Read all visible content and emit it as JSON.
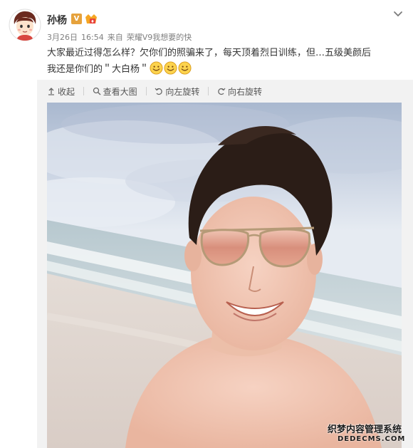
{
  "post": {
    "username": "孙杨",
    "vip_badge": "V",
    "meta": {
      "date": "3月26日",
      "time": "16:54",
      "source_prefix": "来自",
      "device": "荣耀V9",
      "slogan": "我想要的快"
    },
    "text_line1": "大家最近过得怎么样？欠你们的照骗来了，每天顶着烈日训练，但…五级美颜后",
    "text_line2": "我还是你们的＂大白杨＂",
    "emoji_names": [
      "smile-emoji",
      "smile-emoji",
      "smile-emoji"
    ]
  },
  "toolbar": {
    "collapse": "收起",
    "view_large": "查看大图",
    "rotate_left": "向左旋转",
    "rotate_right": "向右旋转"
  },
  "watermark": {
    "title": "织梦内容管理系统",
    "subtitle": "DEDECMS.COM"
  },
  "icons": {
    "collapse": "arrow-up-icon",
    "view_large": "magnifier-icon",
    "rotate_left": "rotate-left-icon",
    "rotate_right": "rotate-right-icon",
    "menu": "chevron-down-icon"
  },
  "colors": {
    "panel_bg": "#f2f2f2",
    "text": "#333333",
    "meta": "#808080",
    "vip": "#e6a23c"
  }
}
